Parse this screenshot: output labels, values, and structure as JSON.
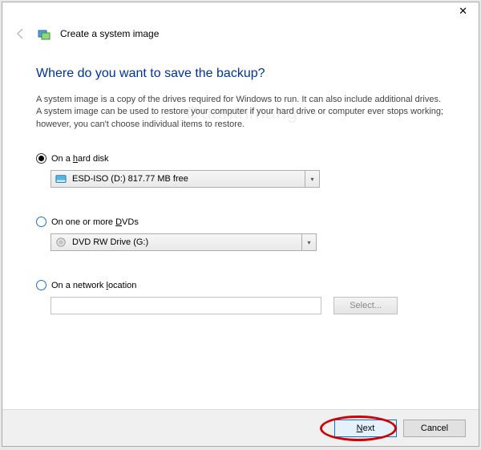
{
  "window": {
    "title": "Create a system image"
  },
  "heading": "Where do you want to save the backup?",
  "description": "A system image is a copy of the drives required for Windows to run. It can also include additional drives. A system image can be used to restore your computer if your hard drive or computer ever stops working; however, you can't choose individual items to restore.",
  "options": {
    "hard_disk": {
      "label_prefix": "On a ",
      "label_underline": "h",
      "label_suffix": "ard disk",
      "selected": true,
      "value": "ESD-ISO (D:)  817.77 MB free"
    },
    "dvds": {
      "label_prefix": "On one or more ",
      "label_underline": "D",
      "label_suffix": "VDs",
      "selected": false,
      "value": "DVD RW Drive (G:)"
    },
    "network": {
      "label_prefix": "On a network ",
      "label_underline": "l",
      "label_suffix": "ocation",
      "selected": false,
      "value": "",
      "select_btn": "Select..."
    }
  },
  "footer": {
    "next_underline": "N",
    "next_suffix": "ext",
    "cancel": "Cancel"
  },
  "watermark": "uantrimang"
}
